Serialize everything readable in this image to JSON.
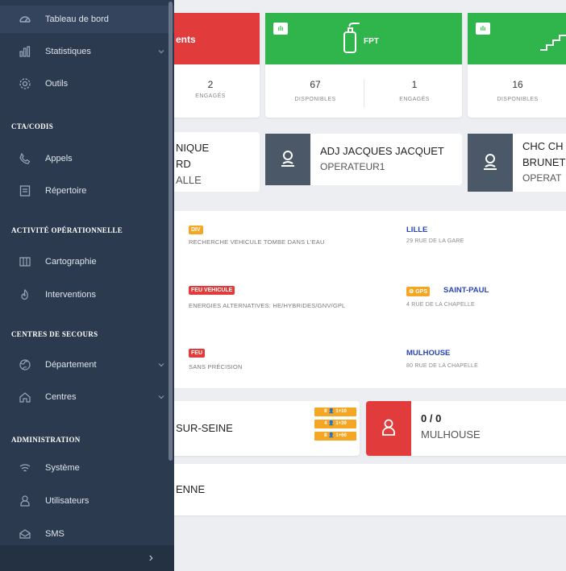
{
  "sidebar": {
    "items": [
      {
        "label": "Tableau de bord",
        "icon": "dashboard-icon"
      },
      {
        "label": "Statistiques",
        "icon": "bar-chart-icon"
      },
      {
        "label": "Outils",
        "icon": "gear-icon"
      },
      {
        "label": "Appels",
        "icon": "phone-icon"
      },
      {
        "label": "Répertoire",
        "icon": "directory-icon"
      },
      {
        "label": "Cartographie",
        "icon": "map-icon"
      },
      {
        "label": "Interventions",
        "icon": "fire-icon"
      },
      {
        "label": "Département",
        "icon": "globe-icon"
      },
      {
        "label": "Centres",
        "icon": "home-icon"
      },
      {
        "label": "Système",
        "icon": "system-icon"
      },
      {
        "label": "Utilisateurs",
        "icon": "user-icon"
      },
      {
        "label": "SMS",
        "icon": "message-icon"
      }
    ],
    "sections": [
      "CTA/CODIS",
      "ACTIVITÉ OPÉRATIONNELLE",
      "CENTRES DE SECOURS",
      "ADMINISTRATION"
    ],
    "collapse_arrow": "›"
  },
  "units": [
    {
      "label": "ents",
      "color": "#e23b3b",
      "stats": [
        {
          "value": "2",
          "label": "ENGAGÉS"
        }
      ]
    },
    {
      "label": "FPT",
      "color": "#2fb54b",
      "badge": "ılı",
      "stats": [
        {
          "value": "67",
          "label": "DISPONIBLES"
        },
        {
          "value": "1",
          "label": "ENGAGÉS"
        }
      ]
    },
    {
      "label": "",
      "color": "#2fb54b",
      "badge": "ılı",
      "stats": [
        {
          "value": "16",
          "label": "DISPONIBLES"
        }
      ]
    }
  ],
  "operators": [
    {
      "name_lines": [
        "NIQUE",
        "RD",
        "ALLE"
      ]
    },
    {
      "name": "ADJ JACQUES JACQUET",
      "role": "OPERATEUR1"
    },
    {
      "name_lines": [
        "CHC CH",
        "BRUNET"
      ],
      "role": "OPERAT"
    }
  ],
  "interventions": [
    {
      "tag": "DIV",
      "tag_color": "#f5a623",
      "desc": "RECHERCHE VEHICULE TOMBE DANS L'EAU",
      "city": "LILLE",
      "addr": "29 RUE DE LA GARE"
    },
    {
      "tag": "FEU VEHICULE",
      "tag_color": "#e23b3b",
      "desc": "ENERGIES ALTERNATIVES: HE/HYBRIDES/GNV/GPL",
      "city_tag": "⚙ GPS",
      "city": "SAINT-PAUL",
      "addr": "4 RUE DE LA CHAPELLE"
    },
    {
      "tag": "FEU",
      "tag_color": "#e23b3b",
      "desc": "SANS PRÉCISION",
      "city": "MULHOUSE",
      "addr": "80 RUE DE LA CHAPELLE"
    }
  ],
  "centres": [
    {
      "name": "SUR-SEINE",
      "mini_tags": [
        "8 👤 1+10",
        "4 👤 1+39",
        "8 👤 1+60"
      ]
    },
    {
      "ratio": "0 / 0",
      "name": "MULHOUSE"
    },
    {
      "name": "ENNE"
    }
  ]
}
